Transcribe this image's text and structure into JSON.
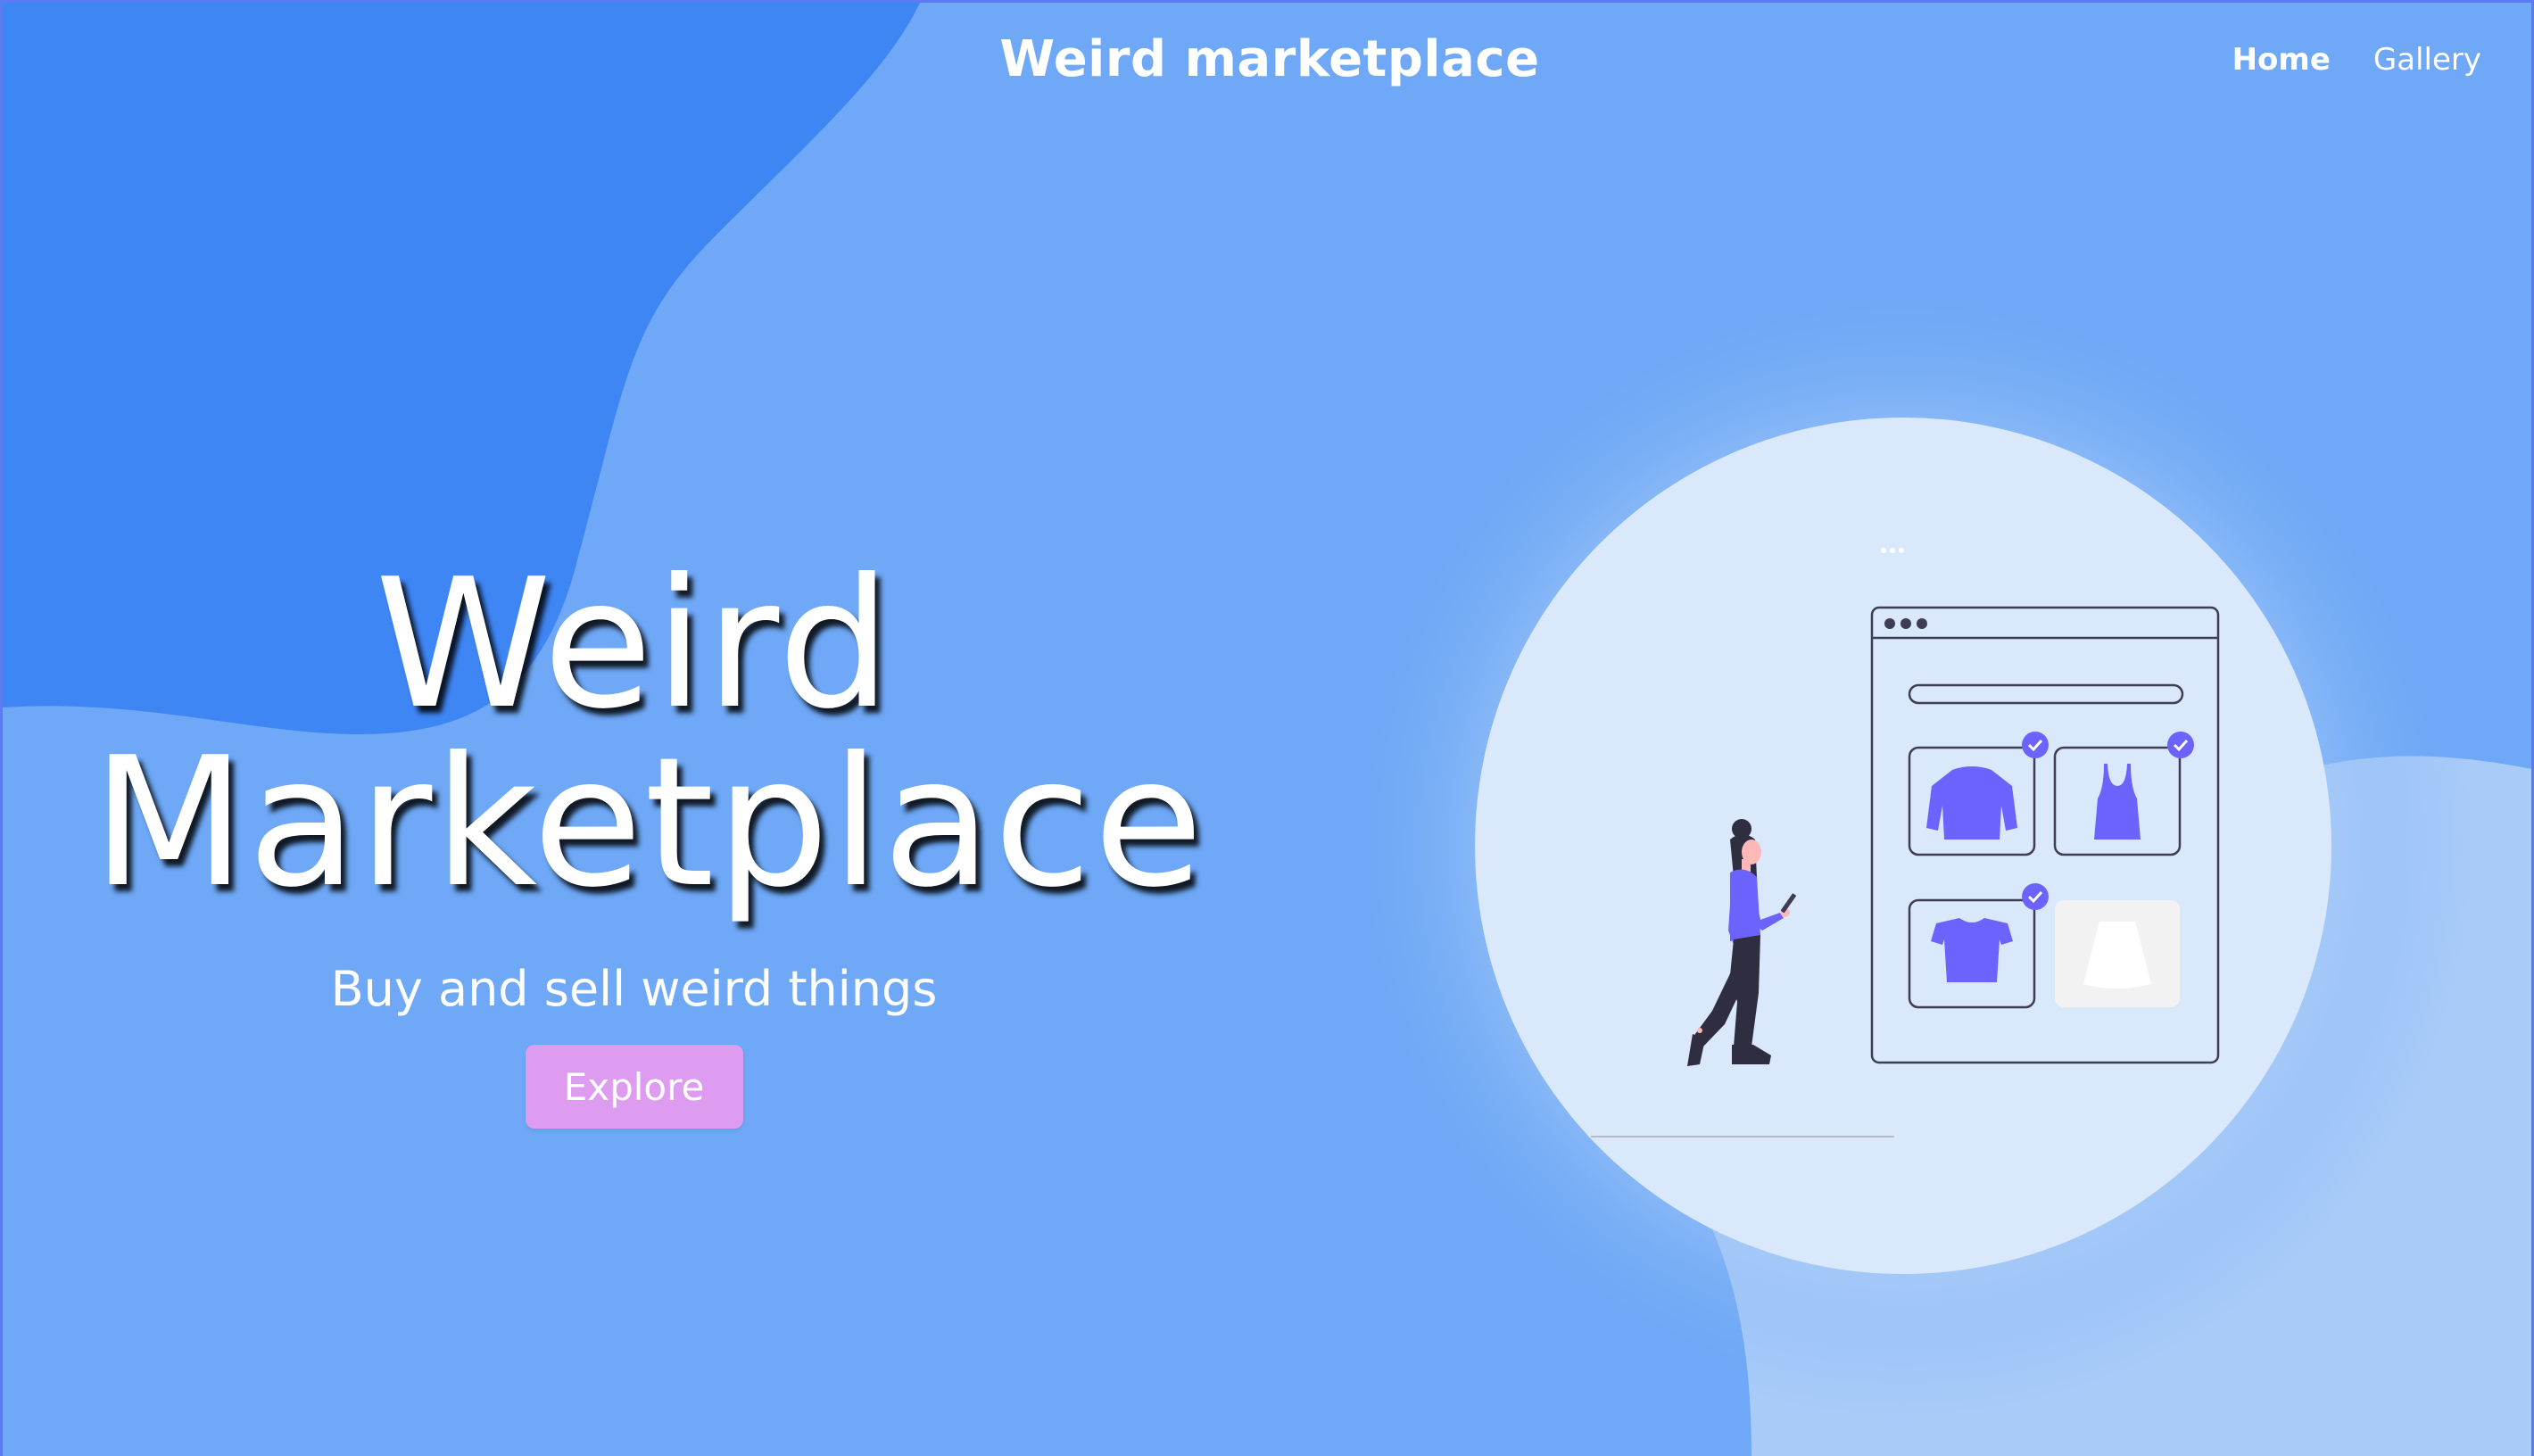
{
  "header": {
    "site_title": "Weird marketplace",
    "nav": [
      {
        "label": "Home",
        "active": true
      },
      {
        "label": "Gallery",
        "active": false
      }
    ]
  },
  "hero": {
    "title_line1": "Weird",
    "title_line2": "Marketplace",
    "subtitle": "Buy and sell weird things",
    "cta_label": "Explore"
  },
  "illustration": {
    "subject": "person-shopping-online-illustration",
    "items": [
      "sweater-icon",
      "tank-top-icon",
      "crop-top-icon",
      "skirt-icon"
    ]
  },
  "colors": {
    "background": "#6ea8f6",
    "dark_blob": "#3f86f5",
    "light_blob": "#a9cbf8",
    "circle": "#d9e8fb",
    "accent_purple": "#6c63ff",
    "button": "#de9cf0",
    "text": "#ffffff"
  }
}
